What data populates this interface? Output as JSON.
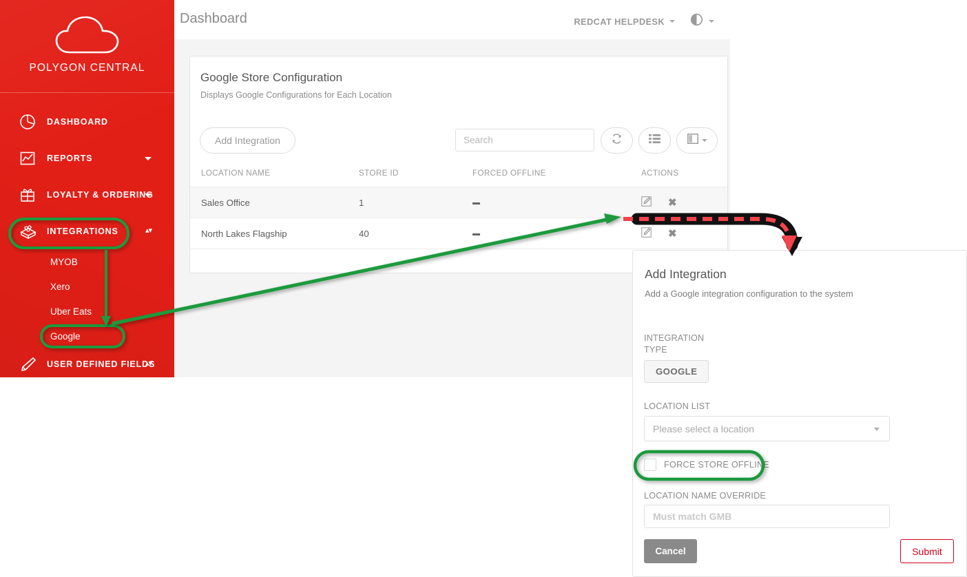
{
  "brand": {
    "name": "POLYGON CENTRAL",
    "logo_icon": "cloud-icon",
    "accent_color": "#e21f17"
  },
  "sidebar": {
    "items": [
      {
        "label": "DASHBOARD",
        "icon": "pie-chart-icon",
        "expandable": false
      },
      {
        "label": "REPORTS",
        "icon": "line-chart-icon",
        "expandable": true
      },
      {
        "label": "LOYALTY & ORDERING",
        "icon": "gift-icon",
        "expandable": true
      },
      {
        "label": "INTEGRATIONS",
        "icon": "blocks-icon",
        "expandable": true
      },
      {
        "label": "USER DEFINED FIELDS",
        "icon": "pen-icon",
        "expandable": true
      }
    ],
    "integrations_children": [
      {
        "label": "MYOB"
      },
      {
        "label": "Xero"
      },
      {
        "label": "Uber Eats"
      },
      {
        "label": "Google"
      }
    ]
  },
  "header": {
    "page_title": "Dashboard",
    "user_menu": "REDCAT HELPDESK",
    "theme_icon": "contrast-circle-icon"
  },
  "card": {
    "title": "Google Store Configuration",
    "subtitle": "Displays Google Configurations for Each Location",
    "add_button": "Add Integration",
    "search_placeholder": "Search",
    "search_value": "",
    "icon_buttons": [
      {
        "name": "refresh-icon",
        "label": ""
      },
      {
        "name": "list-view-icon",
        "label": ""
      },
      {
        "name": "columns-icon",
        "label": ""
      }
    ],
    "table": {
      "columns": [
        "LOCATION NAME",
        "STORE ID",
        "FORCED OFFLINE",
        "ACTIONS"
      ],
      "rows": [
        {
          "location_name": "Sales Office",
          "store_id": "1",
          "forced_offline": "—",
          "actions": [
            "edit-icon",
            "delete-icon"
          ]
        },
        {
          "location_name": "North Lakes Flagship",
          "store_id": "40",
          "forced_offline": "—",
          "actions": [
            "edit-icon",
            "delete-icon"
          ]
        }
      ]
    }
  },
  "modal": {
    "title": "Add Integration",
    "subtitle": "Add a Google integration configuration to the system",
    "integration_type_label": "INTEGRATION TYPE",
    "integration_type_value": "GOOGLE",
    "location_list_label": "LOCATION LIST",
    "location_list_placeholder": "Please select a location",
    "force_offline_label": "FORCE STORE OFFLINE",
    "force_offline_checked": false,
    "location_override_label": "LOCATION NAME OVERRIDE",
    "location_override_placeholder": "Must match GMB",
    "location_override_value": "",
    "cancel_label": "Cancel",
    "submit_label": "Submit"
  },
  "annotations": {
    "highlight_color": "#1a9a3c",
    "pointer_color": "#f4434b",
    "highlighted": [
      "INTEGRATIONS",
      "Google",
      "FORCE STORE OFFLINE"
    ]
  }
}
